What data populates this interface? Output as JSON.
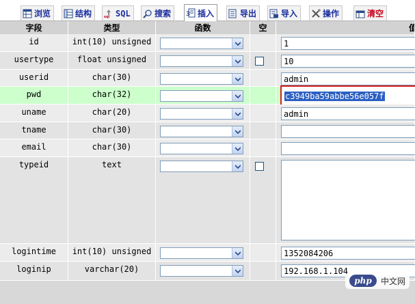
{
  "tabs": [
    {
      "label": "浏览",
      "icon": "browse-icon",
      "active": false,
      "red": false
    },
    {
      "label": "结构",
      "icon": "structure-icon",
      "active": false,
      "red": false
    },
    {
      "label": "SQL",
      "icon": "sql-icon",
      "active": false,
      "red": false
    },
    {
      "label": "搜索",
      "icon": "search-icon",
      "active": false,
      "red": false
    },
    {
      "label": "插入",
      "icon": "insert-icon",
      "active": true,
      "red": false
    },
    {
      "label": "导出",
      "icon": "export-icon",
      "active": false,
      "red": false
    },
    {
      "label": "导入",
      "icon": "import-icon",
      "active": false,
      "red": false
    },
    {
      "label": "操作",
      "icon": "operations-icon",
      "active": false,
      "red": false
    },
    {
      "label": "清空",
      "icon": "empty-icon",
      "active": false,
      "red": true
    }
  ],
  "headers": {
    "field": "字段",
    "type": "类型",
    "function": "函数",
    "null": "空",
    "value": "值"
  },
  "rows": [
    {
      "field": "id",
      "type": "int(10) unsigned",
      "null_checkbox": false,
      "value": "1"
    },
    {
      "field": "usertype",
      "type": "float unsigned",
      "null_checkbox": true,
      "value": "10"
    },
    {
      "field": "userid",
      "type": "char(30)",
      "null_checkbox": false,
      "value": "admin"
    },
    {
      "field": "pwd",
      "type": "char(32)",
      "null_checkbox": false,
      "value": "c3949ba59abbe56e057f"
    },
    {
      "field": "uname",
      "type": "char(20)",
      "null_checkbox": false,
      "value": "admin"
    },
    {
      "field": "tname",
      "type": "char(30)",
      "null_checkbox": false,
      "value": ""
    },
    {
      "field": "email",
      "type": "char(30)",
      "null_checkbox": false,
      "value": ""
    },
    {
      "field": "typeid",
      "type": "text",
      "null_checkbox": true,
      "value": ""
    },
    {
      "field": "logintime",
      "type": "int(10) unsigned",
      "null_checkbox": false,
      "value": "1352084206"
    },
    {
      "field": "loginip",
      "type": "varchar(20)",
      "null_checkbox": false,
      "value": "192.168.1.104"
    }
  ],
  "highlight_row": "pwd",
  "colors": {
    "row_bg": "#ececec",
    "row_alt": "#e3e3e3",
    "highlight_bg": "#ccffcc",
    "tab_text": "#1a2d9e",
    "accent_red": "#d51d1d"
  },
  "watermark": {
    "logo": "php",
    "site": "中文网"
  }
}
